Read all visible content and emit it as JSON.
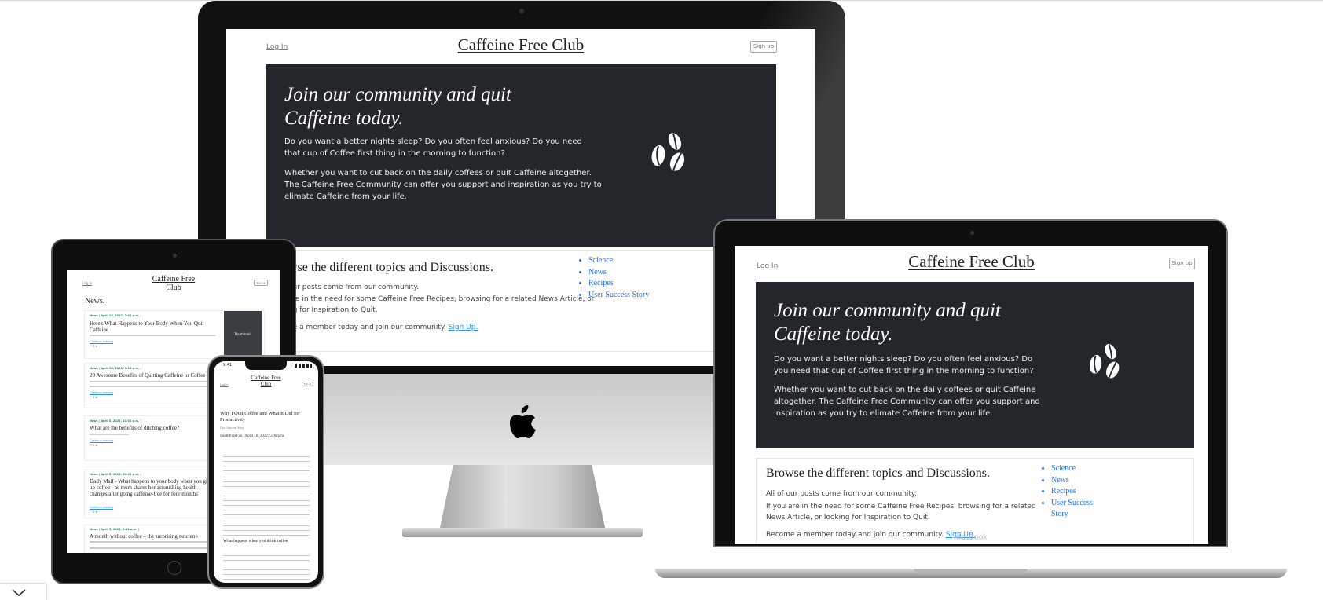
{
  "site": {
    "login": "Log In",
    "title": "Caffeine Free Club",
    "title_line1": "Caffeine Free",
    "title_line2": "Club",
    "signup": "Sign up",
    "hero_line1": "Join our community and quit",
    "hero_line2": "Caffeine today.",
    "hero_p1": "Do you want a better nights sleep? Do you often feel anxious? Do you need that cup of Coffee first thing in the morning to function?",
    "hero_p2": "Whether you want to cut back on the daily coffees or quit Caffeine altogether. The Caffeine Free Community can offer you support and inspiration as you try to elimate Caffeine from your life.",
    "browse_title": "Browse the different topics and Discussions.",
    "browse_p1": "All of our posts come from our community.",
    "browse_p2": "If you are in the need for some Caffeine Free Recipes, browsing for a related News Article, or looking for Inspiration to Quit.",
    "browse_p3": "Become a member today and join our community.",
    "browse_link": "Sign Up.",
    "topics": [
      "Science",
      "News",
      "Recipes",
      "User Success Story"
    ]
  },
  "imac": {
    "browse_title_partial": "wse the different topics and Discussions.",
    "browse_p1_partial": "our posts come from our community.",
    "browse_p2a_partial": "are in the need for some Caffeine Free Recipes, browsing for a related News Article, or",
    "browse_p2b_partial": "ng for Inspiration to Quit.",
    "browse_p3_partial": "ne a member today and join our community."
  },
  "laptop": {
    "brand": "MacBook",
    "topic_story_1": "User Success",
    "topic_story_2": "Story"
  },
  "tablet": {
    "section_title": "News.",
    "thumbnail": "Thumbnail",
    "continue": "Continue reading",
    "posts": [
      {
        "meta": "News | April 16, 2022, 2:01 p.m. |",
        "title": "Here's What Happens to Your Body When You Quit Caffeine",
        "likes": "♡ 0 lk"
      },
      {
        "meta": "News | April 16, 2022, 1:15 p.m. |",
        "title": "20 Awesome Benefits of Quitting Caffeine or Coffee",
        "likes": "♡ 1 lk"
      },
      {
        "meta": "News | April 5, 2022, 10:55 p.m. |",
        "title": "What are the benefits of ditching coffee?",
        "likes": "♡ 0 lk"
      },
      {
        "meta": "News | April 5, 2022, 10:05 p.m. |",
        "title": "Daily Mail - What happens to your body when you give up coffee - as mum shares her astonishing health changes after going caffeine-free for four months",
        "likes": "♡ 0 lk"
      },
      {
        "meta": "News | April 3, 2022, 9:11 p.m. |",
        "title": "A month without coffee – the surprising outcome",
        "likes": ""
      }
    ]
  },
  "phone": {
    "time": "9:41",
    "post_title": "Why I Quit Coffee and What It Did for Productivity",
    "category": "User Success Story",
    "author_line": "SouthParkFan | April 10, 2022, 5:06 p.m.",
    "subheading": "What happens when you drink coffee"
  },
  "colors": {
    "hero_bg": "#23262a",
    "link": "#1e90ff",
    "topic_link": "#1e6fff",
    "tablet_meta": "#1f8a4c"
  },
  "icons": [
    "coffee-beans-icon",
    "apple-logo-icon",
    "chevron-down-icon",
    "heart-icon"
  ]
}
